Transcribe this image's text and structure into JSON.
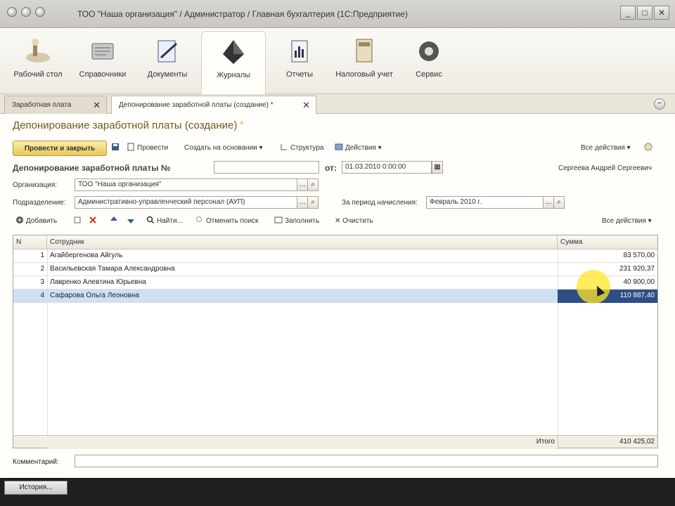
{
  "window": {
    "title": "ТОО \"Наша организация\" / Администратор / Главная бухгалтерия (1С:Предприятие)",
    "controls": [
      "_",
      "□",
      "✕"
    ]
  },
  "sections": [
    {
      "label": "Рабочий стол",
      "icon": "desktop-icon"
    },
    {
      "label": "Справочники",
      "icon": "catalogs-icon"
    },
    {
      "label": "Документы",
      "icon": "documents-icon"
    },
    {
      "label": "Журналы",
      "icon": "journals-icon",
      "active": true
    },
    {
      "label": "Отчеты",
      "icon": "reports-icon"
    },
    {
      "label": "Налоговый учет",
      "icon": "tax-accounting-icon"
    },
    {
      "label": "Сервис",
      "icon": "service-icon"
    }
  ],
  "tabs": [
    {
      "label": "Заработная плата"
    },
    {
      "label": "Депонирование заработной платы (создание) *",
      "active": true
    }
  ],
  "form": {
    "title": "Депонирование заработной платы (создание)",
    "toolbar": {
      "post_and_close": "Провести и закрыть",
      "post": "Провести",
      "create_based_on": "Создать на основании",
      "structure": "Структура",
      "actions": "Действия",
      "all_actions": "Все действия"
    },
    "header_label": "Депонирование заработной платы №",
    "number_value": "",
    "date_label": "от:",
    "date_value": "01.03.2010 0:00:00",
    "author": "Сергеева Андрей Сергеевич",
    "org_label": "Организация:",
    "org_value": "ТОО \"Наша организация\"",
    "dept_label": "Подразделение:",
    "dept_value": "Административно-управленческий персонал (АУП)",
    "period_label": "За период начисления:",
    "period_value": "Февраль 2010 г."
  },
  "table_toolbar": {
    "add": "Добавить",
    "find": "Найти...",
    "cancel_search": "Отменить поиск",
    "fill": "Заполнить",
    "clear": "Очистить",
    "all_actions": "Все действия"
  },
  "table": {
    "columns": [
      "N",
      "Сотрудник",
      "Сумма"
    ],
    "rows": [
      {
        "n": "1",
        "employee": "Агайбергенова Айгуль",
        "sum": "83 570,00"
      },
      {
        "n": "2",
        "employee": "Васильевская Тамара Александровна",
        "sum": "231 920,37"
      },
      {
        "n": "3",
        "employee": "Лавренко Алевтина Юрьевна",
        "sum": "40 900,00"
      },
      {
        "n": "4",
        "employee": "Сафарова Ольга Леоновна",
        "sum": "110 887,40",
        "selected": true
      }
    ],
    "total_label": "Итого",
    "total_value": "410 425,02"
  },
  "comment_label": "Комментарий:",
  "comment_value": "",
  "bottom": {
    "history": "История..."
  }
}
